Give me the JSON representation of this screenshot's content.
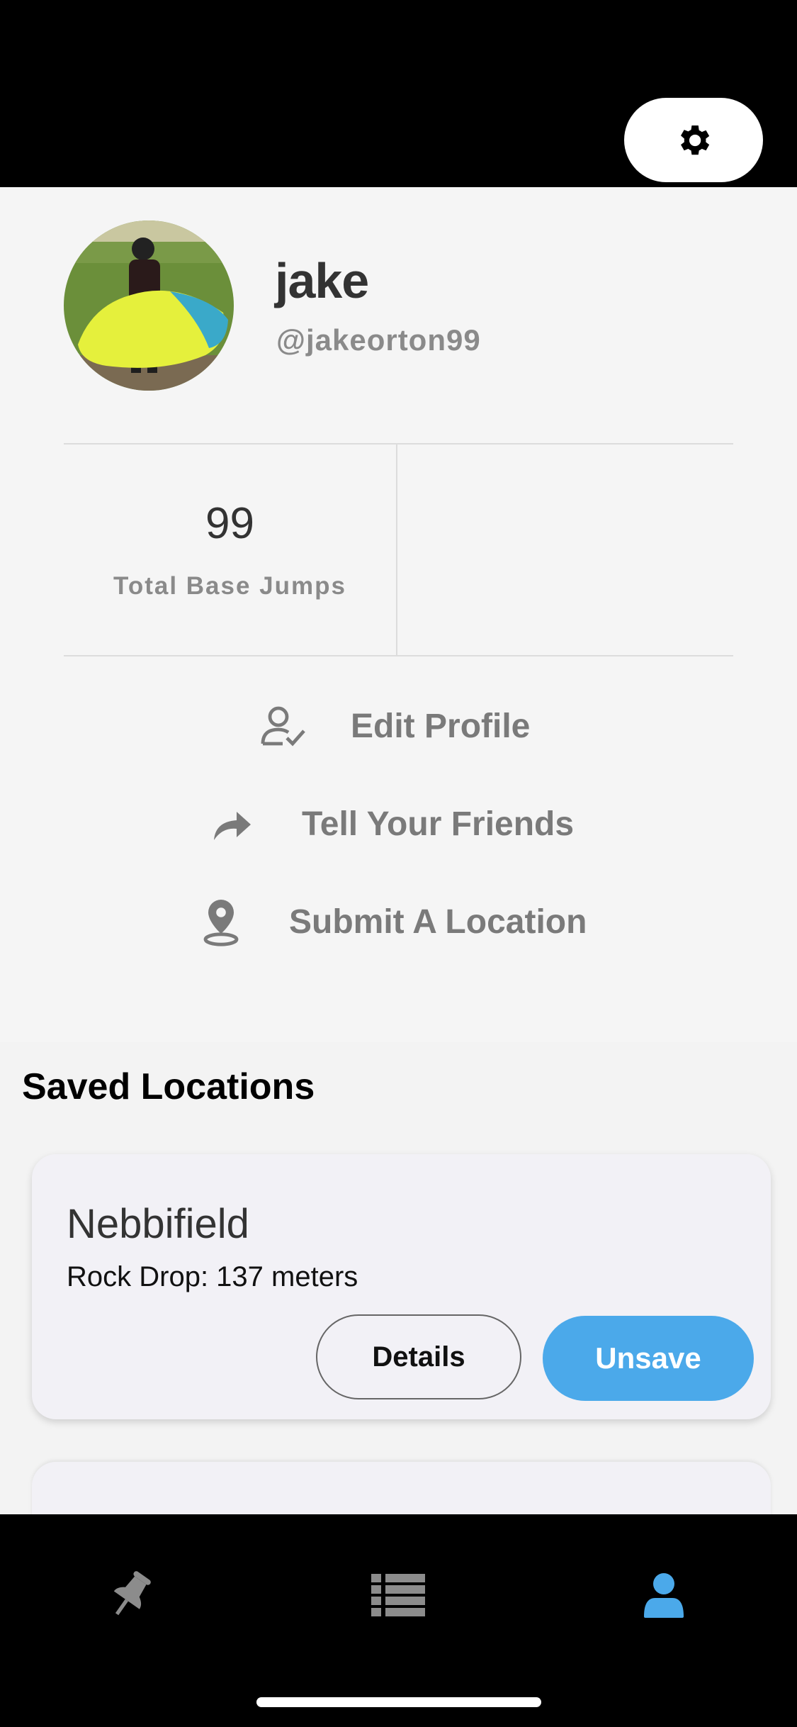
{
  "header": {
    "settings_icon": "gear-icon"
  },
  "profile": {
    "name": "jake",
    "handle": "@jakeorton99",
    "avatar_description": "profile-photo"
  },
  "stats": [
    {
      "value": "99",
      "label": "Total Base Jumps"
    }
  ],
  "actions": [
    {
      "icon": "user-check-icon",
      "label": "Edit Profile"
    },
    {
      "icon": "share-arrow-icon",
      "label": "Tell Your Friends"
    },
    {
      "icon": "map-pin-icon",
      "label": "Submit A Location"
    }
  ],
  "saved": {
    "title": "Saved Locations",
    "items": [
      {
        "name": "Nebbifield",
        "subtitle": "Rock Drop: 137 meters",
        "details_label": "Details",
        "unsave_label": "Unsave"
      }
    ]
  },
  "tabbar": {
    "tabs": [
      {
        "icon": "pushpin-icon",
        "active": false
      },
      {
        "icon": "list-icon",
        "active": false
      },
      {
        "icon": "user-icon",
        "active": true
      }
    ],
    "active_color": "#4ba9ea",
    "inactive_color": "#8c8c8c"
  },
  "colors": {
    "accent": "#4ba9ea",
    "background": "#f5f5f5",
    "card": "#f2f1f6"
  }
}
